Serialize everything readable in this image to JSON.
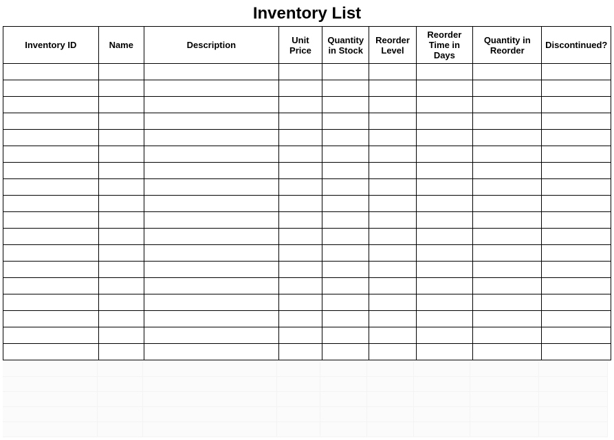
{
  "title": "Inventory List",
  "headers": {
    "inventory_id": "Inventory ID",
    "name": "Name",
    "description": "Description",
    "unit_price": "Unit Price",
    "quantity_in_stock": "Quantity in Stock",
    "reorder_level": "Reorder Level",
    "reorder_time_days": "Reorder Time in Days",
    "quantity_in_reorder": "Quantity in Reorder",
    "discontinued": "Discontinued?"
  },
  "data_row_count": 18,
  "ghost_row_count": 5,
  "rows": []
}
